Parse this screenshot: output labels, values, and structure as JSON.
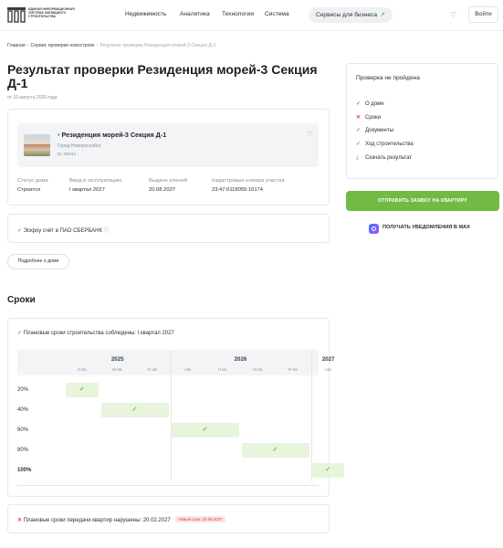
{
  "header": {
    "logo_text": "Единая информационная система жилищного строительства",
    "nav": [
      "Недвижимость",
      "Аналитика",
      "Технологии",
      "Система"
    ],
    "business_button": "Сервисы для бизнеса",
    "business_arrow": "↗",
    "login": "Войти"
  },
  "breadcrumbs": [
    "Главная",
    "Сервис проверки новостроек",
    "Результат проверки Резиденция морей-3 Секция Д-1"
  ],
  "page": {
    "title": "Результат проверки Резиденция морей-3 Секция Д-1",
    "date": "от 10 августа 2026 года"
  },
  "house": {
    "name": "Резиденция морей-3 Секция Д-1",
    "city": "Город Новороссийск",
    "id": "ID: 58434",
    "stats": [
      {
        "label": "Статус дома",
        "value": "Строится"
      },
      {
        "label": "Ввод в эксплуатацию",
        "value": "I квартал 2027"
      },
      {
        "label": "Выдача ключей",
        "value": "20.08.2027"
      },
      {
        "label": "Кадастровые номера участка",
        "value": "23:47:0118055:16174"
      }
    ]
  },
  "escrow": {
    "text": "Эскроу счёт в ПАО СБЕРБАНК",
    "info_icon": "ⓘ"
  },
  "more_button": "Подробнее о доме",
  "terms": {
    "section_title": "Сроки",
    "construction_note": "Плановые сроки строительства соблюдены: I квартал 2027",
    "years": [
      "2025",
      "2026",
      "2027"
    ],
    "quarters": [
      "II кв.",
      "III кв.",
      "IV кв.",
      "I кв.",
      "II кв.",
      "III кв.",
      "IV кв.",
      "I кв."
    ],
    "progress_rows": [
      {
        "label": "20%",
        "quarter_index": 0
      },
      {
        "label": "40%",
        "quarter_index": 1,
        "span": 2
      },
      {
        "label": "60%",
        "quarter_index": 3,
        "span": 2
      },
      {
        "label": "80%",
        "quarter_index": 5,
        "span": 2
      },
      {
        "label": "100%",
        "quarter_index": 7
      }
    ],
    "transfer_note": "Плановые сроки передачи квартир нарушены: 20.02.2027",
    "transfer_badge": "Новый срок: 20.08.2027"
  },
  "sidebar": {
    "title": "Проверка не пройдена",
    "items": [
      {
        "icon": "check",
        "label": "О доме"
      },
      {
        "icon": "cross",
        "label": "Сроки"
      },
      {
        "icon": "check",
        "label": "Документы"
      },
      {
        "icon": "check",
        "label": "Ход строительства"
      },
      {
        "icon": "download",
        "label": "Скачать результат"
      }
    ],
    "send_button": "ОТПРАВИТЬ ЗАЯВКУ НА КВАРТИРУ",
    "max_link": "ПОЛУЧАТЬ УВЕДОМЛЕНИЯ В MAX"
  },
  "colors": {
    "accent_green": "#71bb44",
    "error_red": "#e0453a"
  }
}
